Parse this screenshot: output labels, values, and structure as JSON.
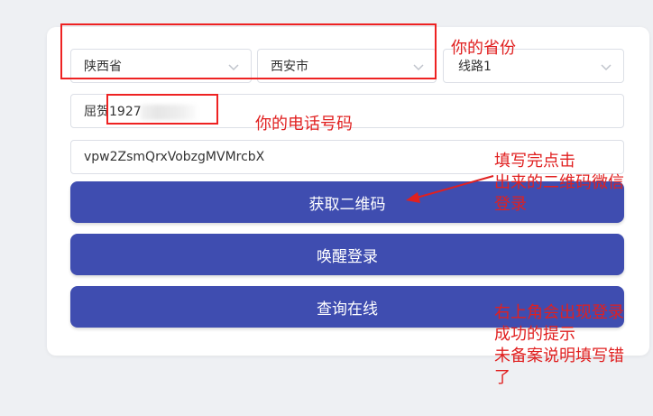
{
  "form": {
    "province": "陕西省",
    "city": "西安市",
    "line": "线路1",
    "phone": "屈贺1927",
    "token": "vpw2ZsmQrxVobzgMVMrcbX"
  },
  "buttons": {
    "get_qr": "获取二维码",
    "wake_login": "唤醒登录",
    "query_online": "查询在线"
  },
  "annotations": {
    "province_note": "你的省份",
    "phone_note": "你的电话号码",
    "qr_note": "填写完点击\n出来的二维码微信\n登录",
    "success_note": "右上角会出现登录\n成功的提示\n未备案说明填写错\n了"
  },
  "colors": {
    "button": "#3f4db0",
    "annotation": "#e02020"
  }
}
